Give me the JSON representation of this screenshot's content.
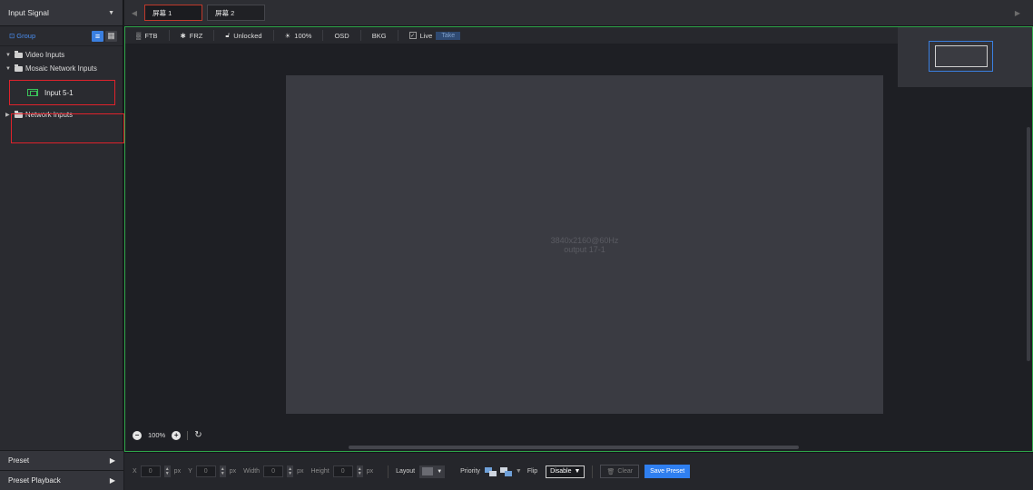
{
  "sidebar": {
    "header": "Input Signal",
    "group_label": "Group",
    "tree": {
      "video_inputs": "Video Inputs",
      "mosaic_inputs": "Mosaic Network Inputs",
      "selected_input": "Input 5-1",
      "network_inputs": "Network Inputs"
    },
    "sections": [
      "Preset",
      "Preset Playback"
    ]
  },
  "tabs": [
    "屏幕 1",
    "屏幕 2"
  ],
  "toolbar": {
    "ftb": "FTB",
    "frz": "FRZ",
    "unlocked": "Unlocked",
    "brightness": "100%",
    "osd": "OSD",
    "bkg": "BKG",
    "live": "Live",
    "take": "Take"
  },
  "screen": {
    "resolution": "3840x2160@60Hz",
    "output": "output 17-1"
  },
  "zoom": {
    "level": "100%"
  },
  "bottom": {
    "x_label": "X",
    "x_value": "0",
    "y_label": "Y",
    "y_value": "0",
    "width_label": "Width",
    "width_value": "0",
    "height_label": "Height",
    "height_value": "0",
    "unit": "px",
    "layout_label": "Layout",
    "priority_label": "Priority",
    "flip_label": "Flip",
    "flip_value": "Disable",
    "clear_label": "Clear",
    "save_label": "Save Preset"
  },
  "colors": {
    "accent": "#2f7ff0",
    "selection_border": "#e0222b",
    "canvas_border": "#2fa64a"
  }
}
